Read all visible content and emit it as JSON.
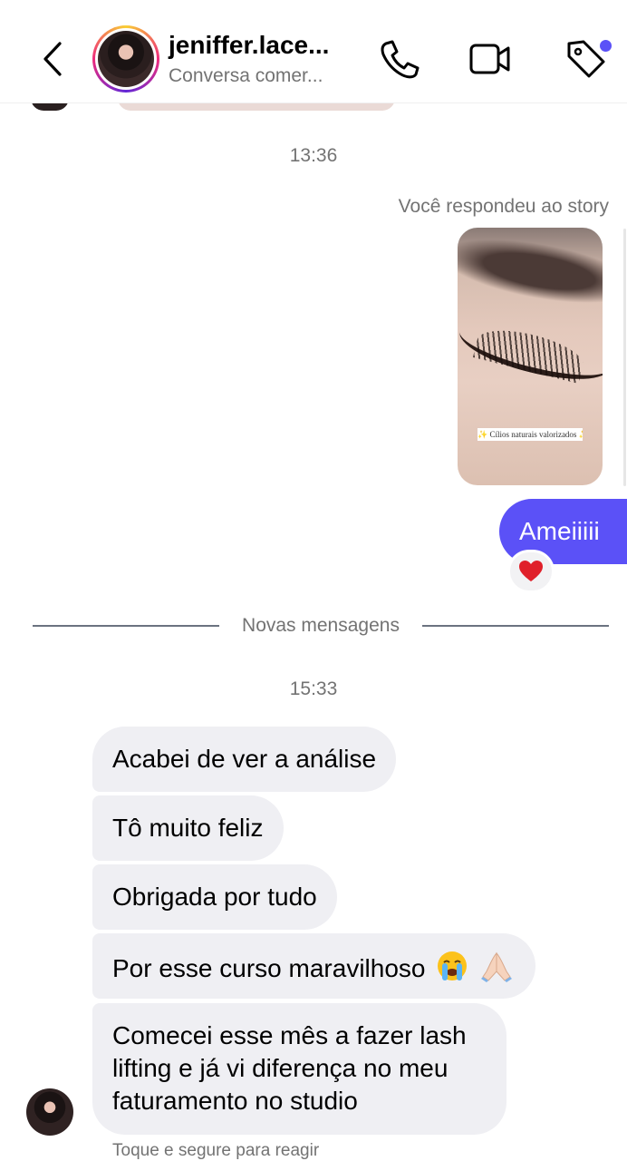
{
  "header": {
    "title": "jeniffer.lace...",
    "subtitle": "Conversa comer..."
  },
  "icons": {
    "back": "chevron-left-icon",
    "phone": "phone-icon",
    "video": "video-camera-icon",
    "tag": "tag-icon",
    "reaction": "red-heart-emoji",
    "emoji1": "loudly-crying-face-emoji",
    "emoji2": "folded-hands-emoji"
  },
  "colors": {
    "sent_bubble": "#5b51f7",
    "received_bubble": "#efeff3",
    "notification_dot": "#5b51f7",
    "muted_text": "#737373"
  },
  "thread": {
    "time1": "13:36",
    "story_reply_label": "Você respondeu ao story",
    "story_caption": "✨ Cílios naturais valorizados ✨",
    "sent_message": "Ameiiiii",
    "reaction": "❤️",
    "divider_label": "Novas mensagens",
    "time2": "15:33",
    "received": [
      "Acabei de ver a análise",
      "Tô muito feliz",
      "Obrigada por tudo",
      "Por esse curso maravilhoso",
      "Comecei esse mês a fazer lash lifting e já vi diferença no meu faturamento no studio"
    ],
    "hint": "Toque e segure para reagir"
  }
}
